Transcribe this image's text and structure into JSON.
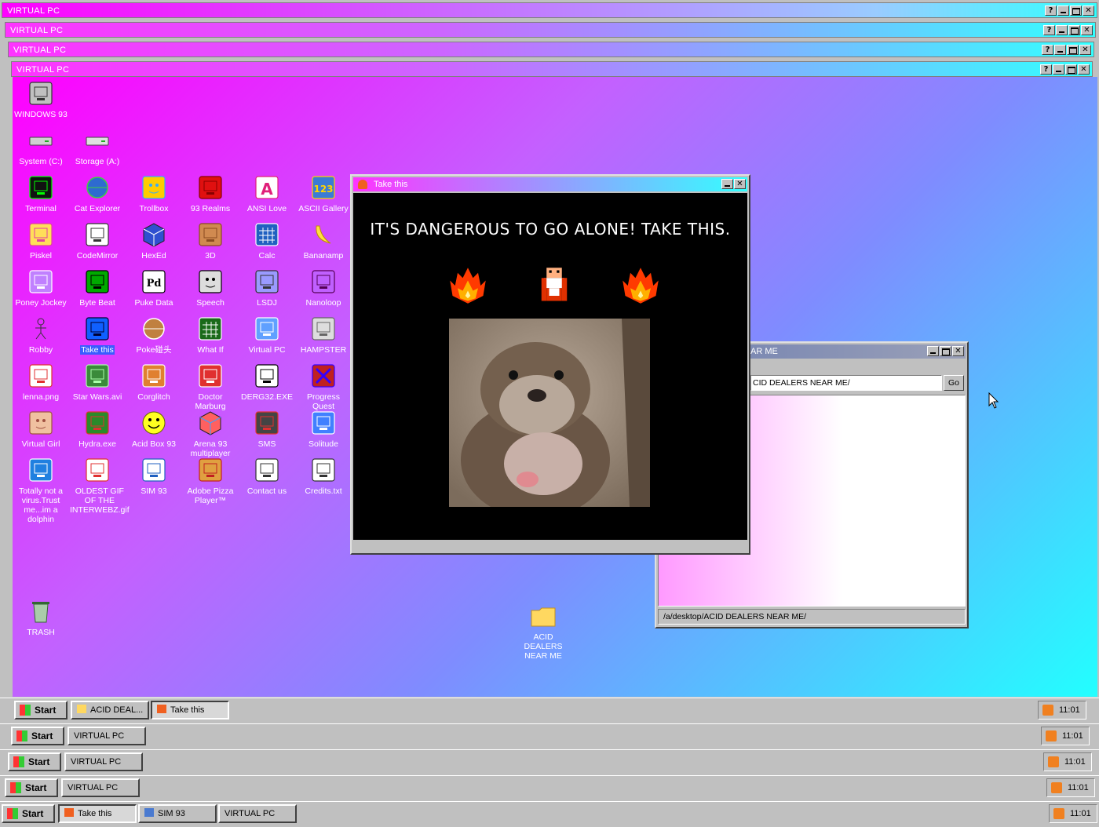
{
  "vpc_window_title": "VIRTUAL PC",
  "desktop": {
    "icons": [
      {
        "id": "windows93",
        "label": "WINDOWS 93"
      },
      {
        "id": "system",
        "label": "System (C:)"
      },
      {
        "id": "storage",
        "label": "Storage (A:)"
      },
      {
        "id": "terminal",
        "label": "Terminal"
      },
      {
        "id": "cat-explorer",
        "label": "Cat Explorer"
      },
      {
        "id": "trollbox",
        "label": "Trollbox"
      },
      {
        "id": "93realms",
        "label": "93 Realms"
      },
      {
        "id": "ansi-love",
        "label": "ANSI Love"
      },
      {
        "id": "ascii-gallery",
        "label": "ASCII Gallery"
      },
      {
        "id": "piskel",
        "label": "Piskel"
      },
      {
        "id": "codemirror",
        "label": "CodeMirror"
      },
      {
        "id": "hexed",
        "label": "HexEd"
      },
      {
        "id": "3d",
        "label": "3D"
      },
      {
        "id": "calc",
        "label": "Calc"
      },
      {
        "id": "bananamp",
        "label": "Bananamp"
      },
      {
        "id": "poney-jockey",
        "label": "Poney Jockey"
      },
      {
        "id": "byte-beat",
        "label": "Byte Beat"
      },
      {
        "id": "puke-data",
        "label": "Puke Data"
      },
      {
        "id": "speech",
        "label": "Speech"
      },
      {
        "id": "lsdj",
        "label": "LSDJ"
      },
      {
        "id": "nanoloop",
        "label": "Nanoloop"
      },
      {
        "id": "robby",
        "label": "Robby"
      },
      {
        "id": "take-this",
        "label": "Take this"
      },
      {
        "id": "pokedex",
        "label": "Poke碰头"
      },
      {
        "id": "what-if",
        "label": "What If"
      },
      {
        "id": "virtual-pc",
        "label": "Virtual PC"
      },
      {
        "id": "hampster",
        "label": "HAMPSTER"
      },
      {
        "id": "lenna",
        "label": "lenna.png"
      },
      {
        "id": "star-wars",
        "label": "Star Wars.avi"
      },
      {
        "id": "corglitch",
        "label": "Corglitch"
      },
      {
        "id": "doctor-marburg",
        "label": "Doctor Marburg"
      },
      {
        "id": "derg32",
        "label": "DERG32.EXE"
      },
      {
        "id": "progress-quest",
        "label": "Progress Quest"
      },
      {
        "id": "virtual-girl",
        "label": "Virtual Girl"
      },
      {
        "id": "hydra",
        "label": "Hydra.exe"
      },
      {
        "id": "acid-box",
        "label": "Acid Box 93"
      },
      {
        "id": "arena93",
        "label": "Arena 93 multiplayer"
      },
      {
        "id": "sms",
        "label": "SMS"
      },
      {
        "id": "solitude",
        "label": "Solitude"
      },
      {
        "id": "dolphin",
        "label": "Totally not a virus.Trust me...im a dolphin"
      },
      {
        "id": "oldest-gif",
        "label": "OLDEST GIF OF THE INTERWEBZ.gif"
      },
      {
        "id": "sim93",
        "label": "SIM 93"
      },
      {
        "id": "adobe-pizza",
        "label": "Adobe Pizza Player™"
      },
      {
        "id": "contact",
        "label": "Contact us"
      },
      {
        "id": "credits",
        "label": "Credits.txt"
      },
      {
        "id": "trash",
        "label": "TRASH"
      },
      {
        "id": "acid-folder",
        "label": "ACID DEALERS NEAR ME"
      }
    ]
  },
  "take_this_window": {
    "title": "Take this",
    "heading": "IT'S DANGEROUS TO GO ALONE! TAKE THIS."
  },
  "explorer_window": {
    "title": "AR ME",
    "address": "CID DEALERS NEAR ME/",
    "go_label": "Go",
    "status": "/a/desktop/ACID DEALERS NEAR ME/"
  },
  "taskbars": [
    {
      "start": "Start",
      "tasks": [
        "ACID DEAL...",
        "Take this"
      ],
      "clock": "11:01"
    },
    {
      "start": "Start",
      "tasks": [
        "VIRTUAL PC"
      ],
      "clock": "11:01"
    },
    {
      "start": "Start",
      "tasks": [
        "VIRTUAL PC"
      ],
      "clock": "11:01"
    },
    {
      "start": "Start",
      "tasks": [
        "VIRTUAL PC"
      ],
      "clock": "11:01"
    },
    {
      "start": "Start",
      "tasks": [
        "Take this",
        "SIM 93",
        "VIRTUAL PC"
      ],
      "clock": "11:01"
    }
  ]
}
